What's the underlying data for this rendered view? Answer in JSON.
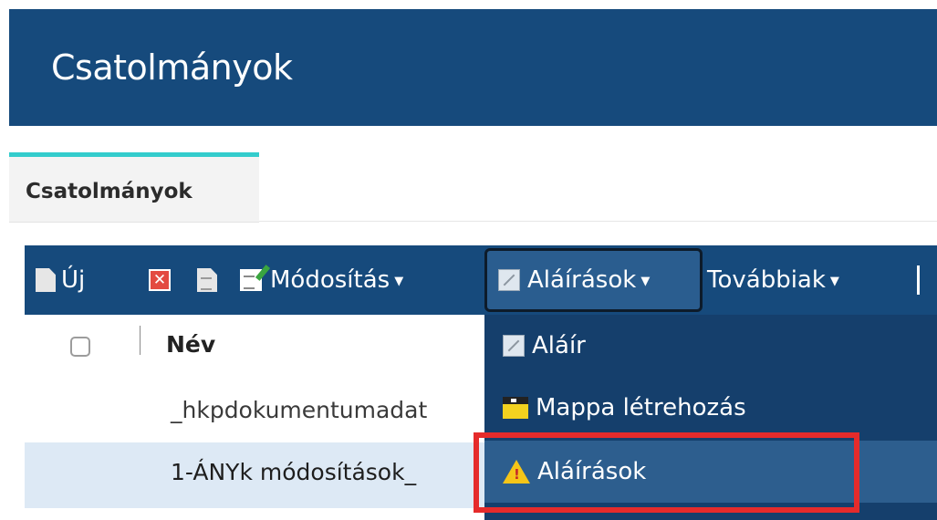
{
  "header": {
    "title": "Csatolmányok"
  },
  "tabs": [
    {
      "label": "Csatolmányok",
      "active": true
    }
  ],
  "toolbar": {
    "new_label": "Új",
    "modify_label": "Módosítás",
    "signatures_label": "Aláírások",
    "more_label": "Továbbiak",
    "icons": {
      "new": "new-document-icon",
      "delete": "delete-icon",
      "copy": "document-icon",
      "modify": "edit-icon",
      "signatures": "signature-icon",
      "caret": "chevron-down-icon"
    }
  },
  "table": {
    "columns": [
      "Név"
    ],
    "rows": [
      {
        "name": "_hkpdokumentumadat",
        "selected": false
      },
      {
        "name": "1-ÁNYk módosítások_",
        "selected": true
      }
    ]
  },
  "dropdown": {
    "items": [
      {
        "label": "Aláír",
        "icon": "signature-icon"
      },
      {
        "label": "Mappa létrehozás",
        "icon": "folder-icon"
      },
      {
        "label": "Aláírások",
        "icon": "warning-icon",
        "active": true
      }
    ]
  },
  "colors": {
    "header_bg": "#164a7c",
    "toolbar_bg": "#164a7c",
    "tab_accent": "#33cccc",
    "selected_row": "#dde9f5",
    "highlight": "#e52b2b",
    "dropdown_bg": "#153f6c"
  }
}
